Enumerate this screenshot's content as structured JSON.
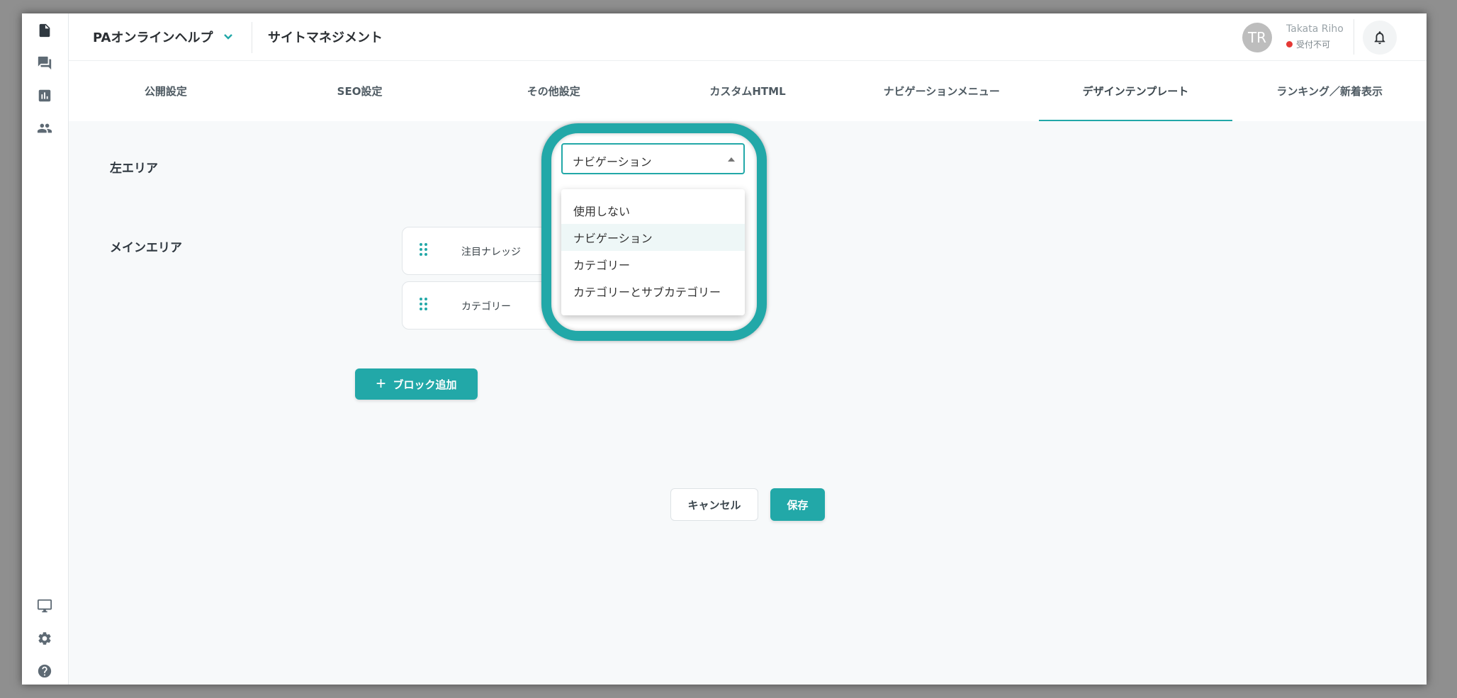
{
  "header": {
    "site_name": "PAオンラインヘルプ",
    "page_title": "サイトマネジメント",
    "user": {
      "initials": "TR",
      "name": "Takata Riho",
      "status": "受付不可",
      "status_color": "#e53935"
    }
  },
  "rail": {
    "top_icons": [
      "document-icon",
      "chat-icon",
      "chart-icon",
      "people-icon"
    ],
    "bottom_icons": [
      "monitor-icon",
      "gear-icon",
      "help-icon"
    ]
  },
  "tabs": [
    {
      "label": "公開設定"
    },
    {
      "label": "SEO設定"
    },
    {
      "label": "その他設定"
    },
    {
      "label": "カスタムHTML"
    },
    {
      "label": "ナビゲーションメニュー"
    },
    {
      "label": "デザインテンプレート",
      "active": true
    },
    {
      "label": "ランキング／新着表示"
    }
  ],
  "form": {
    "left_area_label": "左エリア",
    "main_area_label": "メインエリア",
    "left_area_select": {
      "value": "ナビゲーション",
      "options": [
        "使用しない",
        "ナビゲーション",
        "カテゴリー",
        "カテゴリーとサブカテゴリー"
      ],
      "selected_index": 1
    },
    "blocks": [
      {
        "label": "注目ナレッジ"
      },
      {
        "label": "カテゴリー"
      }
    ],
    "add_block_label": "ブロック追加",
    "add_block_icon": "+",
    "cancel_label": "キャンセル",
    "save_label": "保存"
  },
  "colors": {
    "accent": "#22a8a8",
    "highlight_ring": "#22a8a8",
    "background": "#f7f9fa"
  }
}
